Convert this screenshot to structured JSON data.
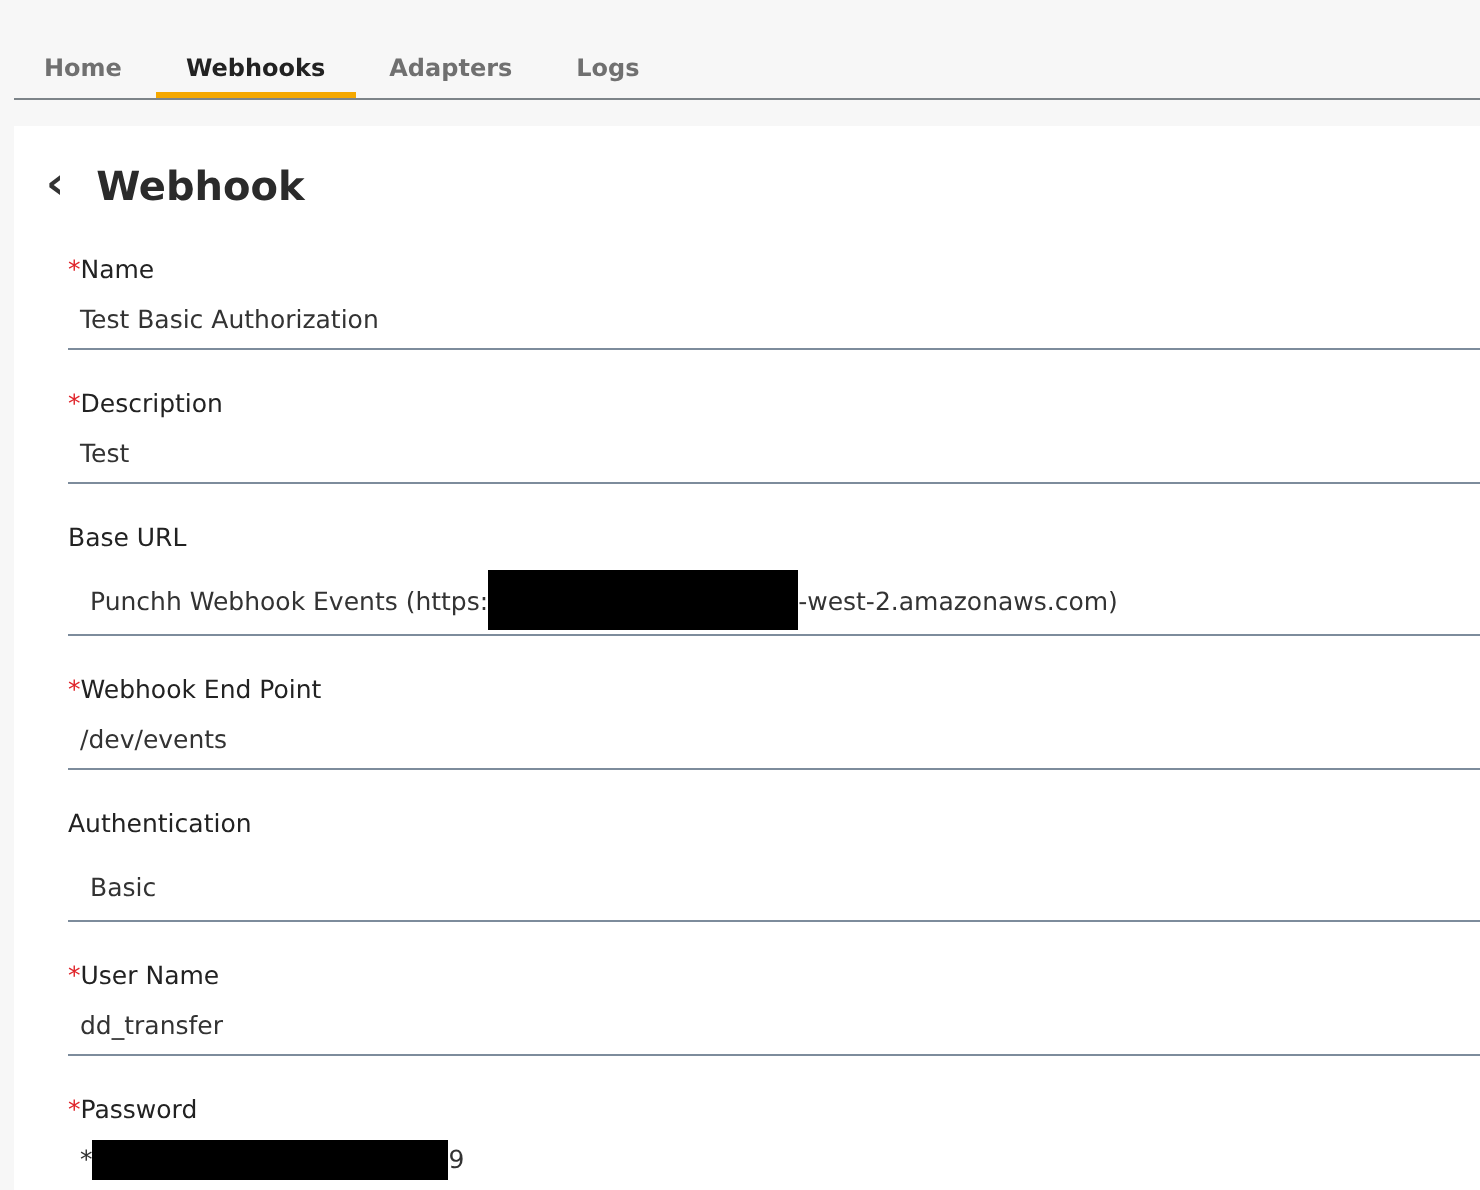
{
  "tabs": [
    {
      "label": "Home",
      "selected": false
    },
    {
      "label": "Webhooks",
      "selected": true
    },
    {
      "label": "Adapters",
      "selected": false
    },
    {
      "label": "Logs",
      "selected": false
    }
  ],
  "page": {
    "back": "‹",
    "title": "Webhook"
  },
  "fields": [
    {
      "kind": "text",
      "required_mark": "*",
      "label": "Name",
      "value": "Test Basic Authorization"
    },
    {
      "kind": "text",
      "required_mark": "*",
      "label": "Description",
      "value": "Test"
    },
    {
      "kind": "select",
      "label": "Base URL",
      "value": "Punchh Webhook Events (https:",
      "redacted": true,
      "value_after": "-west-2.amazonaws.com)"
    },
    {
      "kind": "text",
      "required_mark": "*",
      "label": "Webhook End Point",
      "value": "/dev/events"
    },
    {
      "kind": "select",
      "label": "Authentication",
      "value": "Basic"
    },
    {
      "kind": "text",
      "required_mark": "*",
      "label": "User Name",
      "value": "dd_transfer"
    },
    {
      "kind": "text",
      "required_mark": "*",
      "label": "Password",
      "value": "*",
      "redacted": true,
      "value_after": "9"
    }
  ]
}
